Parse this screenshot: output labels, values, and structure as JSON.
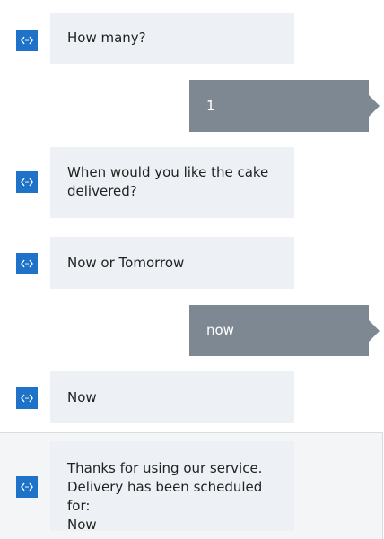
{
  "messages": [
    {
      "from": "bot",
      "text": "How many?"
    },
    {
      "from": "user",
      "text": "1"
    },
    {
      "from": "bot",
      "text": "When would you like the cake delivered?"
    },
    {
      "from": "bot",
      "text": "Now or Tomorrow"
    },
    {
      "from": "user",
      "text": "now"
    },
    {
      "from": "bot",
      "text": "Now"
    },
    {
      "from": "bot",
      "lines": [
        "Thanks for using our service.",
        "Delivery has been scheduled for:",
        "Now"
      ]
    }
  ],
  "icons": {
    "bot_avatar": "code-brackets-icon"
  },
  "colors": {
    "bot_avatar": "#1e73c8",
    "bot_bubble": "#edf0f4",
    "user_bubble": "#7d8893",
    "selected_row": "#f4f5f7"
  }
}
